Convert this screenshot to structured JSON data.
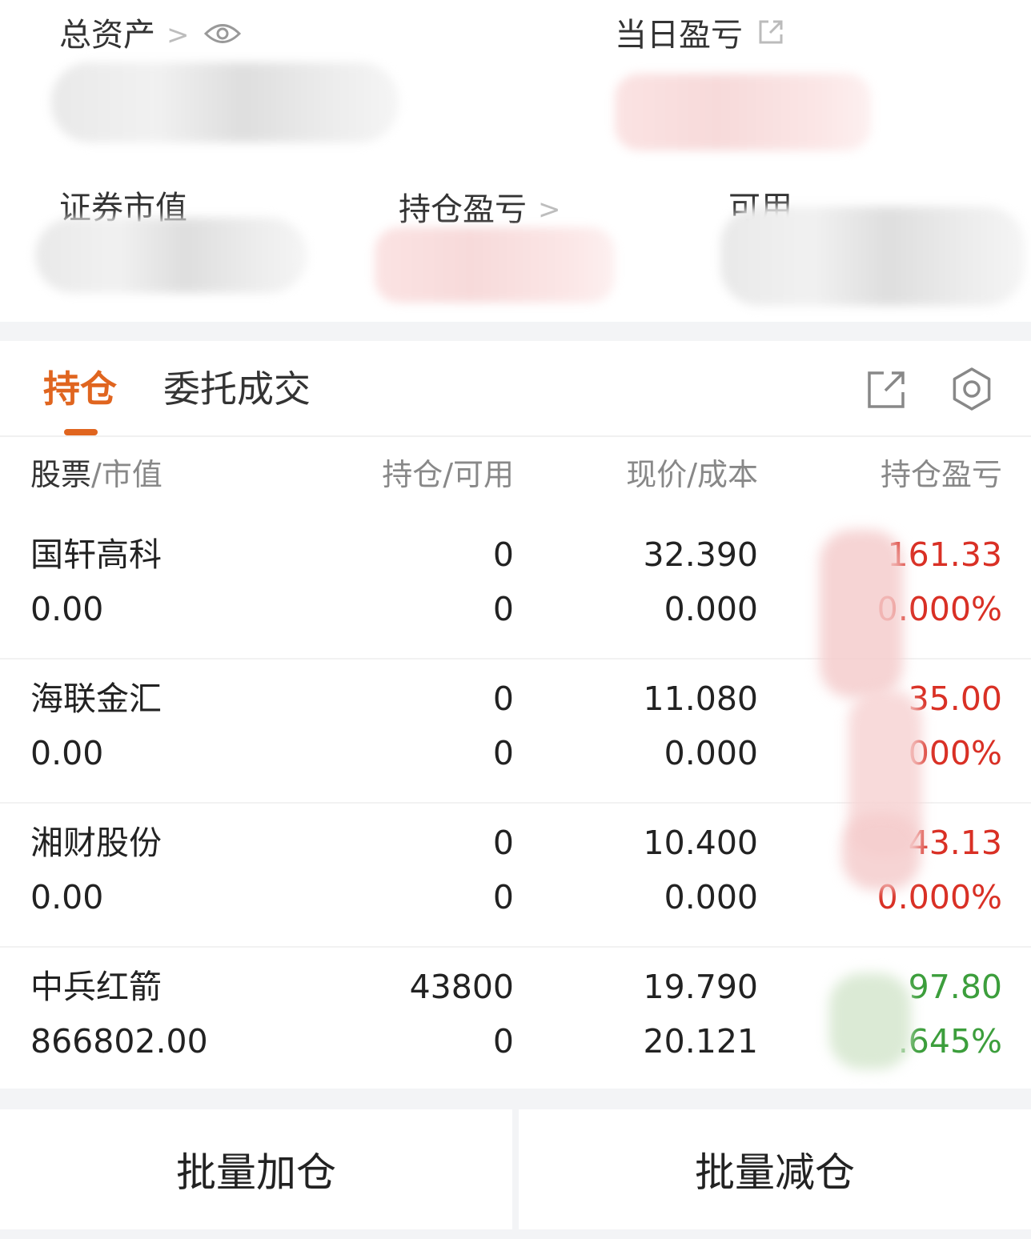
{
  "summary": {
    "total_assets_label": "总资产",
    "daily_pl_label": "当日盈亏",
    "market_value_label": "证券市值",
    "position_pl_label": "持仓盈亏",
    "available_label": "可用",
    "chevron": ">"
  },
  "tabs": {
    "active": "持仓",
    "inactive": "委托成交"
  },
  "table": {
    "headers": {
      "col1_primary": "股票",
      "col1_secondary": "/市值",
      "col2": "持仓/可用",
      "col3": "现价/成本",
      "col4": "持仓盈亏"
    },
    "rows": [
      {
        "name": "国轩高科",
        "market_value": "0.00",
        "holding": "0",
        "available": "0",
        "price": "32.390",
        "cost": "0.000",
        "pl": "161.33",
        "pl_pct": "0.000%",
        "trend": "red"
      },
      {
        "name": "海联金汇",
        "market_value": "0.00",
        "holding": "0",
        "available": "0",
        "price": "11.080",
        "cost": "0.000",
        "pl": "35.00",
        "pl_pct": "000%",
        "trend": "red"
      },
      {
        "name": "湘财股份",
        "market_value": "0.00",
        "holding": "0",
        "available": "0",
        "price": "10.400",
        "cost": "0.000",
        "pl": "43.13",
        "pl_pct": "0.000%",
        "trend": "red"
      },
      {
        "name": "中兵红箭",
        "market_value": "866802.00",
        "holding": "43800",
        "available": "0",
        "price": "19.790",
        "cost": "20.121",
        "pl": "97.80",
        "pl_pct": ".645%",
        "trend": "green"
      }
    ]
  },
  "actions": {
    "batch_add": "批量加仓",
    "batch_reduce": "批量减仓"
  },
  "colors": {
    "accent": "#e0651f",
    "loss_up": "#d93025",
    "gain_down": "#3c9e3c"
  },
  "icons": [
    "eye-icon",
    "external-link-icon",
    "share-icon",
    "gear-icon",
    "chevron-right-icon"
  ]
}
